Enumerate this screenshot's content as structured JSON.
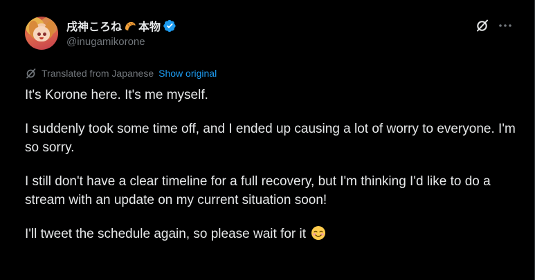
{
  "author": {
    "display_name": "戌神ころね",
    "name_suffix": "本物",
    "handle": "@inugamikorone",
    "verified": true
  },
  "translation": {
    "label": "Translated from Japanese",
    "show_original_label": "Show original"
  },
  "tweet": {
    "paragraphs": [
      "It's Korone here. It's me myself.",
      "I suddenly took some time off, and I ended up causing a lot of worry to everyone. I'm so sorry.",
      "I still don't have a clear timeline for a full recovery, but I'm thinking I'd like to do a stream with an update on my current situation soon!",
      "I'll tweet the schedule again, so please wait for it"
    ]
  },
  "icons": {
    "avatar": "avatar",
    "croissant": "croissant-icon",
    "verified": "verified-badge-icon",
    "grok": "grok-icon",
    "more": "more-icon",
    "translate": "translate-icon",
    "emoji": "smiling-face-with-blush-icon"
  },
  "colors": {
    "background": "#000000",
    "text_primary": "#e7e9ea",
    "text_secondary": "#71767b",
    "link": "#1d9bf0",
    "verified": "#1d9bf0"
  }
}
